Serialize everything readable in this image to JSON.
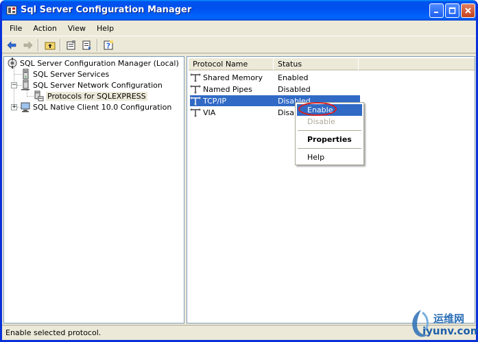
{
  "window": {
    "title": "Sql Server Configuration Manager",
    "buttons": {
      "minimize_icon": "minimize-icon",
      "maximize_icon": "maximize-icon",
      "close_icon": "close-icon"
    }
  },
  "menubar": {
    "items": [
      "File",
      "Action",
      "View",
      "Help"
    ]
  },
  "toolbar": {
    "icons": [
      "back-arrow-icon",
      "forward-arrow-icon",
      "up-folder-icon",
      "properties-icon",
      "export-list-icon",
      "help-icon"
    ]
  },
  "tree": {
    "items": [
      {
        "label": "SQL Server Configuration Manager (Local)",
        "icon": "config-manager-icon"
      },
      {
        "label": "SQL Server Services",
        "icon": "server-icon"
      },
      {
        "label": "SQL Server Network Configuration",
        "icon": "network-icon"
      },
      {
        "label": "Protocols for SQLEXPRESS",
        "icon": "protocols-icon"
      },
      {
        "label": "SQL Native Client 10.0 Configuration",
        "icon": "client-icon"
      }
    ]
  },
  "list": {
    "columns": [
      "Protocol Name",
      "Status"
    ],
    "rows": [
      {
        "name": "Shared Memory",
        "status": "Enabled"
      },
      {
        "name": "Named Pipes",
        "status": "Disabled"
      },
      {
        "name": "TCP/IP",
        "status": "Disabled"
      },
      {
        "name": "VIA",
        "status": "Disab"
      }
    ],
    "selected_index": 2
  },
  "context_menu": {
    "items": [
      "Enable",
      "Disable",
      "Properties",
      "Help"
    ]
  },
  "statusbar": {
    "text": "Enable selected protocol."
  },
  "watermark": {
    "cn": "运维网",
    "en": "iyunv.com"
  },
  "colors": {
    "titlebar": "#0053ee",
    "selection": "#316ac5",
    "highlight_circle": "#d81e1e",
    "window_bg": "#ece9d8"
  }
}
